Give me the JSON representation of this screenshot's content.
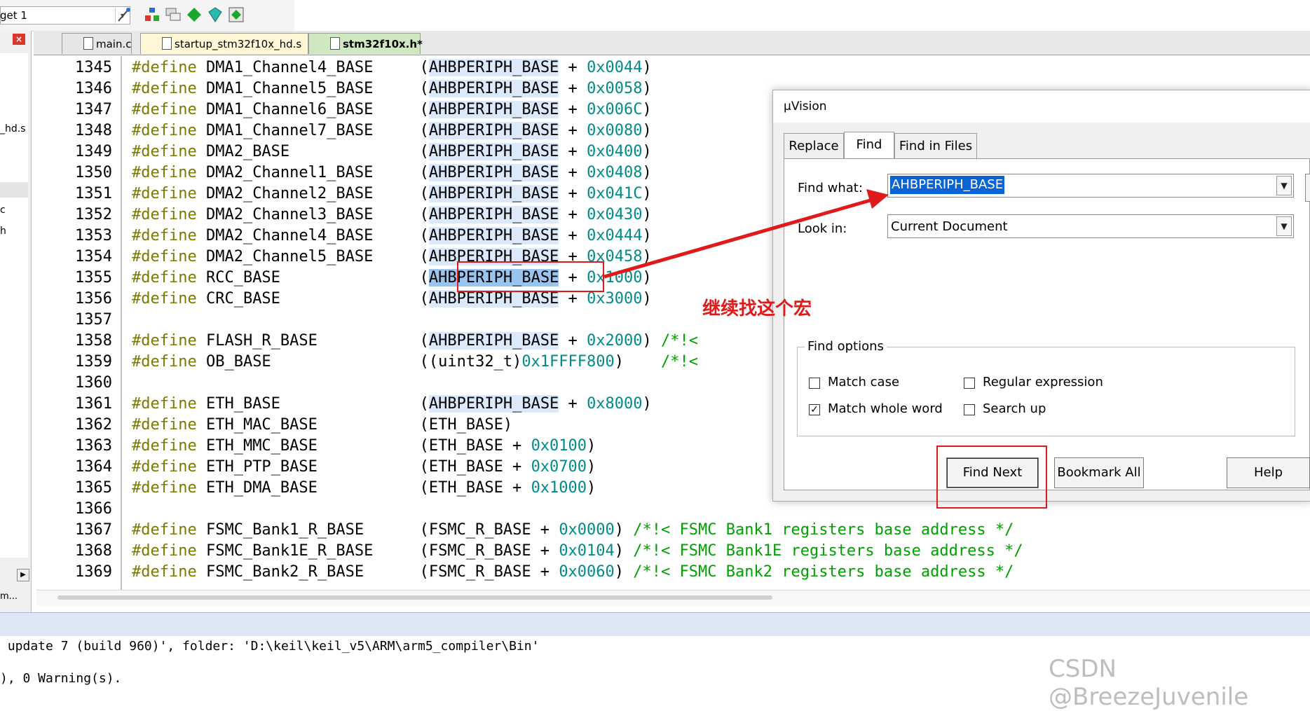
{
  "toolbar": {
    "target_text": "get 1",
    "dropdown_glyph": "▾"
  },
  "left_panel": {
    "close_glyph": "×",
    "items": [
      "_hd.s",
      "c",
      "h"
    ],
    "scroll_glyph": "▶",
    "bottom_text": "m..."
  },
  "tabs": [
    {
      "label": "main.c",
      "active": false
    },
    {
      "label": "startup_stm32f10x_hd.s",
      "active": false
    },
    {
      "label": "stm32f10x.h*",
      "active": true
    }
  ],
  "editor": {
    "lines": [
      {
        "num": "1345",
        "define": "#define",
        "name": " DMA1_Channel4_BASE",
        "pad": "     ",
        "base": "AHBPERIPH_BASE",
        "op": " + ",
        "hex": "0x0044",
        "close": ")",
        "comment": ""
      },
      {
        "num": "1346",
        "define": "#define",
        "name": " DMA1_Channel5_BASE",
        "pad": "     ",
        "base": "AHBPERIPH_BASE",
        "op": " + ",
        "hex": "0x0058",
        "close": ")",
        "comment": ""
      },
      {
        "num": "1347",
        "define": "#define",
        "name": " DMA1_Channel6_BASE",
        "pad": "     ",
        "base": "AHBPERIPH_BASE",
        "op": " + ",
        "hex": "0x006C",
        "close": ")",
        "comment": ""
      },
      {
        "num": "1348",
        "define": "#define",
        "name": " DMA1_Channel7_BASE",
        "pad": "     ",
        "base": "AHBPERIPH_BASE",
        "op": " + ",
        "hex": "0x0080",
        "close": ")",
        "comment": ""
      },
      {
        "num": "1349",
        "define": "#define",
        "name": " DMA2_BASE",
        "pad": "              ",
        "base": "AHBPERIPH_BASE",
        "op": " + ",
        "hex": "0x0400",
        "close": ")",
        "comment": ""
      },
      {
        "num": "1350",
        "define": "#define",
        "name": " DMA2_Channel1_BASE",
        "pad": "     ",
        "base": "AHBPERIPH_BASE",
        "op": " + ",
        "hex": "0x0408",
        "close": ")",
        "comment": ""
      },
      {
        "num": "1351",
        "define": "#define",
        "name": " DMA2_Channel2_BASE",
        "pad": "     ",
        "base": "AHBPERIPH_BASE",
        "op": " + ",
        "hex": "0x041C",
        "close": ")",
        "comment": ""
      },
      {
        "num": "1352",
        "define": "#define",
        "name": " DMA2_Channel3_BASE",
        "pad": "     ",
        "base": "AHBPERIPH_BASE",
        "op": " + ",
        "hex": "0x0430",
        "close": ")",
        "comment": ""
      },
      {
        "num": "1353",
        "define": "#define",
        "name": " DMA2_Channel4_BASE",
        "pad": "     ",
        "base": "AHBPERIPH_BASE",
        "op": " + ",
        "hex": "0x0444",
        "close": ")",
        "comment": ""
      },
      {
        "num": "1354",
        "define": "#define",
        "name": " DMA2_Channel5_BASE",
        "pad": "     ",
        "base": "AHBPERIPH_BASE",
        "op": " + ",
        "hex": "0x0458",
        "close": ")",
        "comment": ""
      },
      {
        "num": "1355",
        "define": "#define",
        "name": " RCC_BASE",
        "pad": "               ",
        "base": "AHBPERIPH_BASE",
        "op": " + ",
        "hex": "0x1000",
        "close": ")",
        "comment": "",
        "selected": true
      },
      {
        "num": "1356",
        "define": "#define",
        "name": " CRC_BASE",
        "pad": "               ",
        "base": "AHBPERIPH_BASE",
        "op": " + ",
        "hex": "0x3000",
        "close": ")",
        "comment": ""
      },
      {
        "num": "1357",
        "define": "",
        "name": "",
        "pad": "",
        "base": "",
        "op": "",
        "hex": "",
        "close": "",
        "comment": ""
      },
      {
        "num": "1358",
        "define": "#define",
        "name": " FLASH_R_BASE",
        "pad": "           ",
        "base": "AHBPERIPH_BASE",
        "op": " + ",
        "hex": "0x2000",
        "close": ")",
        "comment": " /*!<"
      },
      {
        "num": "1359",
        "define": "#define",
        "name": " OB_BASE",
        "pad": "                ",
        "raw": "((uint32_t)",
        "hex": "0x1FFFF800",
        "close": ")",
        "comment": "    /*!<"
      },
      {
        "num": "1360",
        "define": "",
        "name": "",
        "pad": "",
        "base": "",
        "op": "",
        "hex": "",
        "close": "",
        "comment": ""
      },
      {
        "num": "1361",
        "define": "#define",
        "name": " ETH_BASE",
        "pad": "               ",
        "base": "AHBPERIPH_BASE",
        "op": " + ",
        "hex": "0x8000",
        "close": ")",
        "comment": ""
      },
      {
        "num": "1362",
        "define": "#define",
        "name": " ETH_MAC_BASE",
        "pad": "           ",
        "raw": "(ETH_BASE)",
        "hex": "",
        "close": "",
        "comment": ""
      },
      {
        "num": "1363",
        "define": "#define",
        "name": " ETH_MMC_BASE",
        "pad": "           ",
        "raw": "(ETH_BASE + ",
        "hex": "0x0100",
        "close": ")",
        "comment": ""
      },
      {
        "num": "1364",
        "define": "#define",
        "name": " ETH_PTP_BASE",
        "pad": "           ",
        "raw": "(ETH_BASE + ",
        "hex": "0x0700",
        "close": ")",
        "comment": ""
      },
      {
        "num": "1365",
        "define": "#define",
        "name": " ETH_DMA_BASE",
        "pad": "           ",
        "raw": "(ETH_BASE + ",
        "hex": "0x1000",
        "close": ")",
        "comment": ""
      },
      {
        "num": "1366",
        "define": "",
        "name": "",
        "pad": "",
        "base": "",
        "op": "",
        "hex": "",
        "close": "",
        "comment": ""
      },
      {
        "num": "1367",
        "define": "#define",
        "name": " FSMC_Bank1_R_BASE",
        "pad": "      ",
        "raw": "(FSMC_R_BASE + ",
        "hex": "0x0000",
        "close": ")",
        "comment": " /*!< FSMC Bank1 registers base address */"
      },
      {
        "num": "1368",
        "define": "#define",
        "name": " FSMC_Bank1E_R_BASE",
        "pad": "     ",
        "raw": "(FSMC_R_BASE + ",
        "hex": "0x0104",
        "close": ")",
        "comment": " /*!< FSMC Bank1E registers base address */"
      },
      {
        "num": "1369",
        "define": "#define",
        "name": " FSMC_Bank2_R_BASE",
        "pad": "      ",
        "raw": "(FSMC_R_BASE + ",
        "hex": "0x0060",
        "close": ")",
        "comment": " /*!< FSMC Bank2 registers base address */"
      }
    ]
  },
  "output": {
    "line1": " update 7 (build 960)', folder: 'D:\\keil\\keil_v5\\ARM\\arm5_compiler\\Bin'",
    "line2": "), 0 Warning(s)."
  },
  "dialog": {
    "title": "µVision",
    "tabs": [
      "Replace",
      "Find",
      "Find in Files"
    ],
    "active_tab": "Find",
    "find_what_label": "Find what:",
    "find_what_value": "AHBPERIPH_BASE",
    "look_in_label": "Look in:",
    "look_in_value": "Current Document",
    "drop_glyph": "▼",
    "options_legend": "Find options",
    "options": [
      {
        "label": "Match case",
        "checked": false
      },
      {
        "label": "Regular expression",
        "checked": false
      },
      {
        "label": "Match whole word",
        "checked": true
      },
      {
        "label": "Search up",
        "checked": false
      }
    ],
    "check_glyph": "✓",
    "buttons": {
      "find_next": "Find Next",
      "bookmark_all": "Bookmark All",
      "help": "Help"
    }
  },
  "annotation": {
    "text": "继续找这个宏",
    "color": "#e01a1a"
  },
  "watermark": "CSDN @BreezeJuvenile",
  "colors": {
    "keyword": "#7a7a00",
    "hex": "#008b8b",
    "comment": "#00a000",
    "highlight": "#dbe9fb",
    "selection": "#0a64d6"
  }
}
